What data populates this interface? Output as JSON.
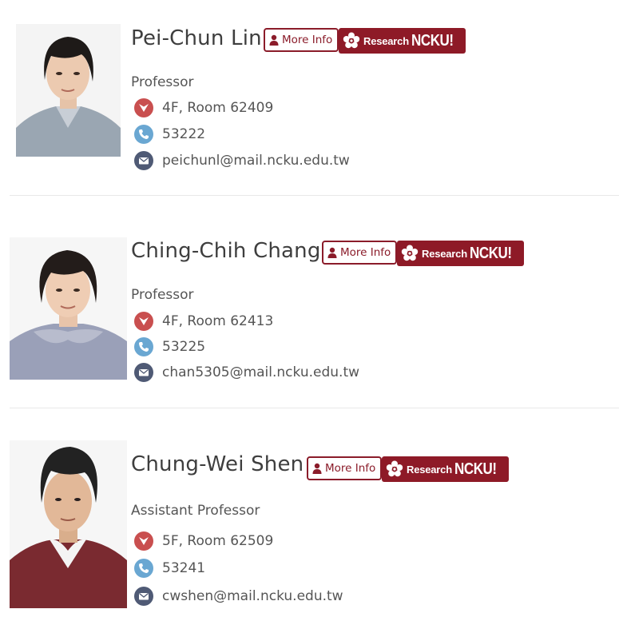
{
  "people": [
    {
      "name": "Pei-Chun Lin",
      "title": "Professor",
      "office": "4F, Room 62409",
      "phone": "53222",
      "email": "peichunl@mail.ncku.edu.tw",
      "more_info_label": "More Info",
      "research_label_small": "Research",
      "research_label_brand": "NCKU!"
    },
    {
      "name": "Ching-Chih Chang",
      "title": "Professor",
      "office": "4F, Room 62413",
      "phone": "53225",
      "email": "chan5305@mail.ncku.edu.tw",
      "more_info_label": "More Info",
      "research_label_small": "Research",
      "research_label_brand": "NCKU!"
    },
    {
      "name": "Chung-Wei Shen",
      "title": "Assistant Professor",
      "office": "5F, Room 62509",
      "phone": "53241",
      "email": "cwshen@mail.ncku.edu.tw",
      "more_info_label": "More Info",
      "research_label_small": "Research",
      "research_label_brand": "NCKU!"
    }
  ],
  "icons": {
    "location": "location-icon",
    "phone": "phone-icon",
    "email": "envelope-icon",
    "more_info": "person-icon",
    "research": "ncku-flower-logo"
  },
  "colors": {
    "accent": "#8e1a27",
    "location_icon": "#c94f4f",
    "phone_icon": "#6aa7d2",
    "email_icon": "#4f5a75"
  }
}
